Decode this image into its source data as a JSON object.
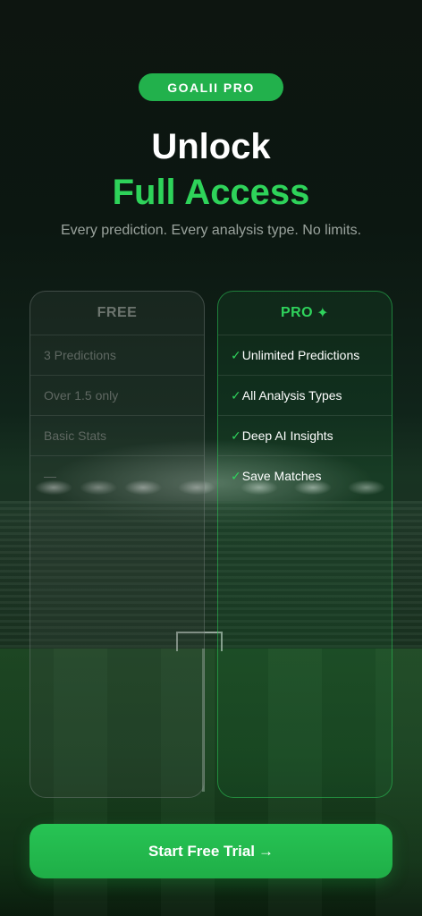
{
  "badge": "GOALII PRO",
  "headline": {
    "line1": "Unlock",
    "line2": "Full Access"
  },
  "subtitle": "Every prediction. Every analysis type. No limits.",
  "plans": {
    "free": {
      "name": "FREE",
      "features": [
        "3 Predictions",
        "Over 1.5 only",
        "Basic Stats",
        "—"
      ]
    },
    "pro": {
      "name": "PRO",
      "name_icon": "✦",
      "check": "✓",
      "features": [
        "Unlimited Predictions",
        "All Analysis Types",
        "Deep AI Insights",
        "Save Matches"
      ]
    }
  },
  "cta": {
    "label": "Start Free Trial",
    "arrow": "→"
  },
  "colors": {
    "accent": "#22b14c",
    "accent_text": "#2ed35a",
    "background": "#0b120d"
  },
  "icons": [
    "sparkle-icon",
    "checkmark-icon",
    "arrow-right-icon"
  ]
}
